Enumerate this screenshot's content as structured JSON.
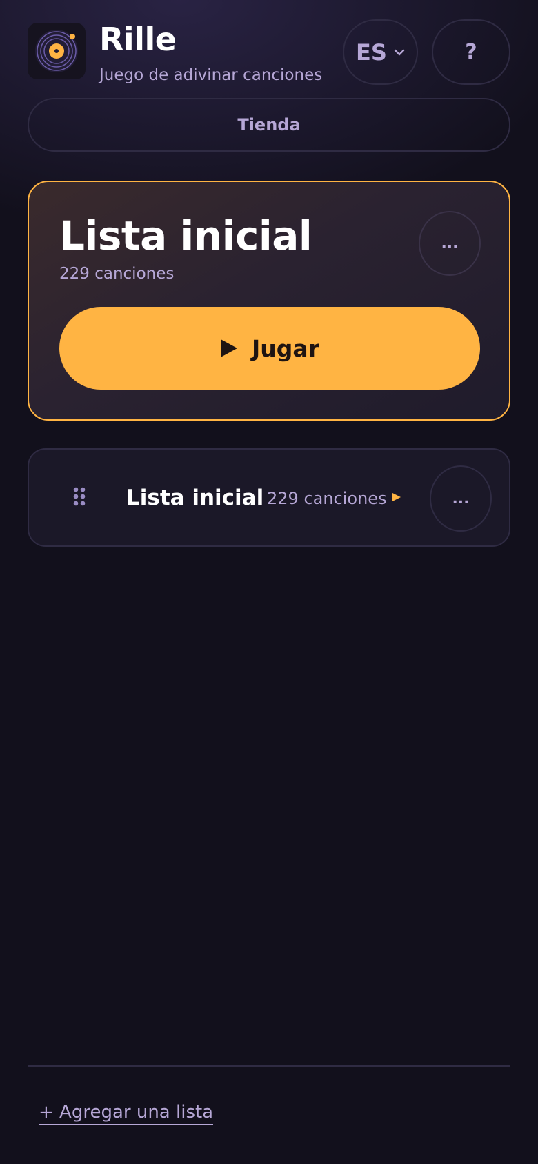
{
  "header": {
    "app_title": "Rille",
    "app_subtitle": "Juego de adivinar canciones",
    "language": "ES",
    "help_label": "?",
    "store_label": "Tienda"
  },
  "featured": {
    "title": "Lista inicial",
    "count": "229 canciones",
    "more_label": "...",
    "play_label": "Jugar"
  },
  "lists": [
    {
      "title": "Lista inicial",
      "count": "229 canciones",
      "more_label": "..."
    }
  ],
  "footer": {
    "add_list_label": "+ Agregar una lista"
  },
  "colors": {
    "background": "#12101c",
    "accent": "#ffb443",
    "muted_text": "#b6a7d6",
    "border": "#2f2b43"
  }
}
